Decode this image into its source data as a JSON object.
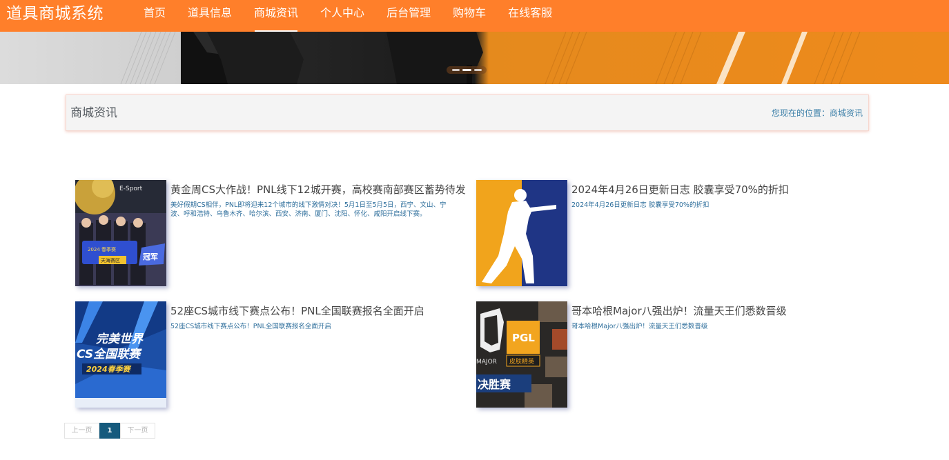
{
  "header": {
    "brand": "道具商城系统",
    "nav": [
      {
        "label": "首页",
        "active": false
      },
      {
        "label": "道具信息",
        "active": false
      },
      {
        "label": "商城资讯",
        "active": true
      },
      {
        "label": "个人中心",
        "active": false
      },
      {
        "label": "后台管理",
        "active": false
      },
      {
        "label": "购物车",
        "active": false
      },
      {
        "label": "在线客服",
        "active": false
      }
    ]
  },
  "banner": {
    "accent_color": "#e8881e",
    "dots": 3,
    "current_dot": 2
  },
  "breadcrumb": {
    "title": "商城资讯",
    "prefix": "您现在的位置：",
    "current": "商城资讯"
  },
  "news": [
    {
      "title": "黄金周CS大作战！PNL线下12城开赛，高校赛南部赛区蓄势待发",
      "summary": "美好假期CS相伴，PNL即将迎来12个城市的线下激情对决！5月1日至5月5日，西宁、文山、宁波、呼和浩特、乌鲁木齐、哈尔滨、西安、济南、厦门、沈阳、怀化、咸阳开启线下赛。",
      "thumb_texts": [
        "E-Sport",
        "2024 春季赛",
        "天海赛区",
        "冠军"
      ]
    },
    {
      "title": "2024年4月26日更新日志 胶囊享受70%的折扣",
      "summary": "2024年4月26日更新日志 胶囊享受70%的折扣",
      "thumb_texts": []
    },
    {
      "title": "52座CS城市线下赛点公布！PNL全国联赛报名全面开启",
      "summary": "52座CS城市线下赛点公布！PNL全国联赛报名全面开启",
      "thumb_texts": [
        "完美世界",
        "CS全国联赛",
        "2024春季赛"
      ]
    },
    {
      "title": "哥本哈根Major八强出炉！流量天王们悉数晋级",
      "summary": "哥本哈根Major八强出炉！流量天王们悉数晋级",
      "thumb_texts": [
        "PGL",
        "MAJOR",
        "皮肤精英",
        "决胜赛"
      ]
    }
  ],
  "pagination": {
    "prev": "上一页",
    "current": "1",
    "next": "下一页"
  }
}
